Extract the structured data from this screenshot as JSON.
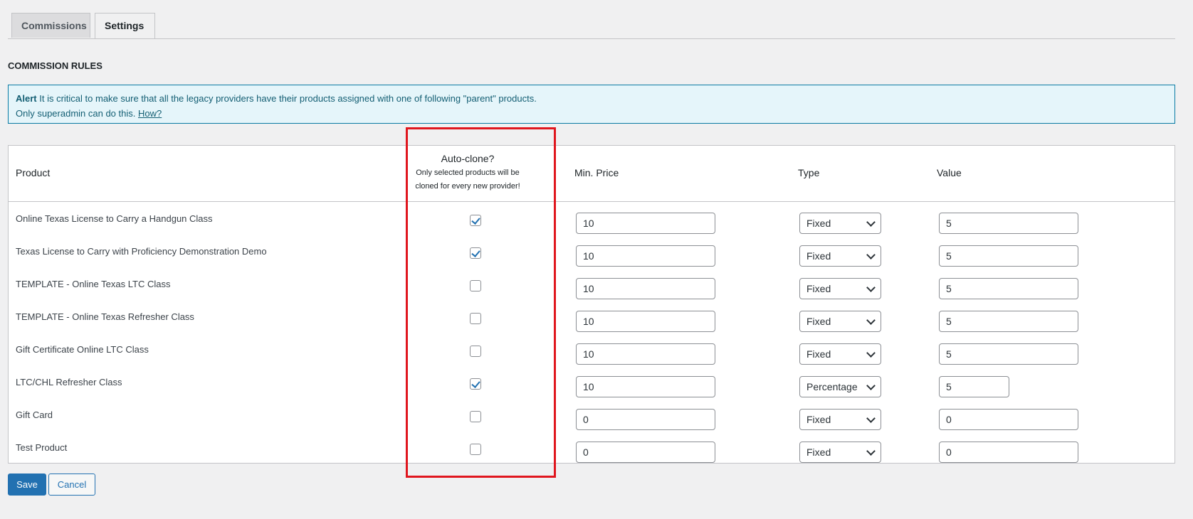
{
  "tabs": {
    "commissions": "Commissions",
    "settings": "Settings"
  },
  "section_title": "COMMISSION RULES",
  "alert": {
    "label": "Alert",
    "line1": "It is critical to make sure that all the legacy providers have their products assigned with one of following \"parent\" products.",
    "line2": "Only superadmin can do this.",
    "link": "How?"
  },
  "table": {
    "headers": {
      "product": "Product",
      "auto_clone": "Auto-clone?",
      "auto_clone_note_1": "Only selected products will be",
      "auto_clone_note_2": "cloned for every new provider!",
      "min_price": "Min. Price",
      "type": "Type",
      "value": "Value"
    },
    "rows": [
      {
        "product": "Online Texas License to Carry a Handgun Class",
        "auto_clone": true,
        "min_price": "10",
        "type": "Fixed",
        "value": "5"
      },
      {
        "product": "Texas License to Carry with Proficiency Demonstration Demo",
        "auto_clone": true,
        "min_price": "10",
        "type": "Fixed",
        "value": "5"
      },
      {
        "product": "TEMPLATE - Online Texas LTC Class",
        "auto_clone": false,
        "min_price": "10",
        "type": "Fixed",
        "value": "5"
      },
      {
        "product": "TEMPLATE - Online Texas Refresher Class",
        "auto_clone": false,
        "min_price": "10",
        "type": "Fixed",
        "value": "5"
      },
      {
        "product": "Gift Certificate Online LTC Class",
        "auto_clone": false,
        "min_price": "10",
        "type": "Fixed",
        "value": "5"
      },
      {
        "product": "LTC/CHL Refresher Class",
        "auto_clone": true,
        "min_price": "10",
        "type": "Percentage",
        "value": "5"
      },
      {
        "product": "Gift Card",
        "auto_clone": false,
        "min_price": "0",
        "type": "Fixed",
        "value": "0"
      },
      {
        "product": "Test Product",
        "auto_clone": false,
        "min_price": "0",
        "type": "Fixed",
        "value": "0"
      }
    ]
  },
  "buttons": {
    "save": "Save",
    "cancel": "Cancel"
  },
  "colors": {
    "primary": "#2271b1",
    "highlight": "#e0161e",
    "alert_bg": "#e5f5fa"
  }
}
